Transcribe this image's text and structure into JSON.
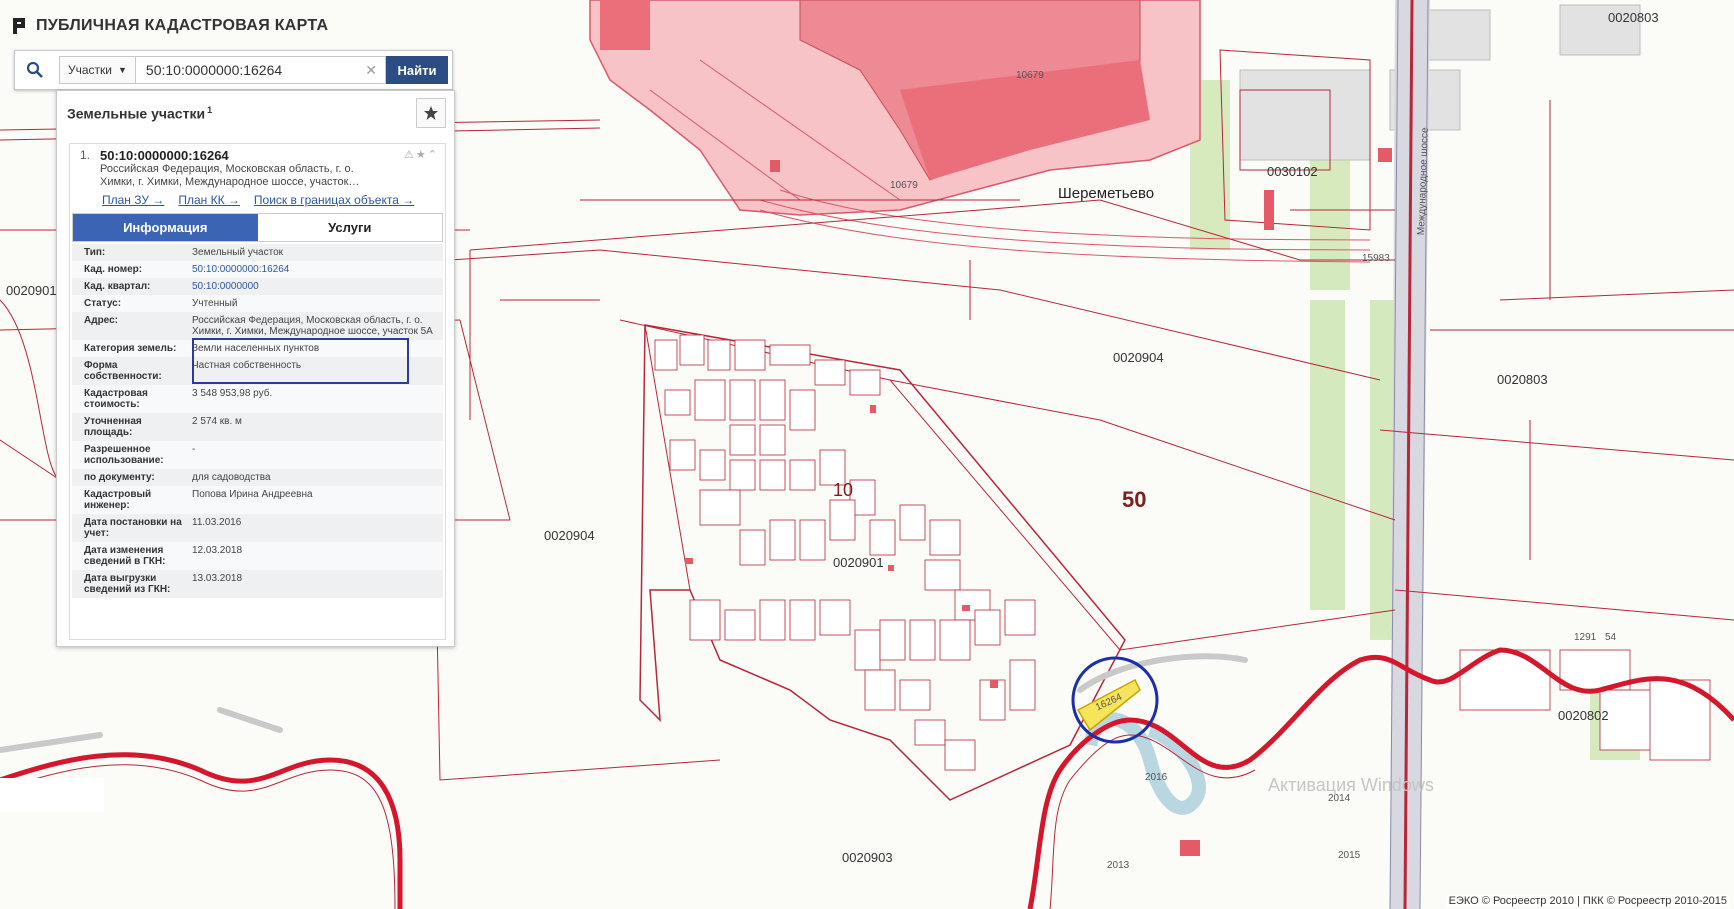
{
  "header": {
    "title": "ПУБЛИЧНАЯ КАДАСТРОВАЯ КАРТА"
  },
  "search": {
    "type_label": "Участки",
    "query": "50:10:0000000:16264",
    "find_label": "Найти"
  },
  "panel": {
    "title": "Земельные участки",
    "count": "1",
    "result": {
      "index": "1.",
      "cad_number": "50:10:0000000:16264",
      "address_short_1": "Российская Федерация, Московская область, г. о.",
      "address_short_2": "Химки, г. Химки, Международное шоссе, участок…",
      "links": [
        "План ЗУ →",
        "План КК →",
        "Поиск в границах объекта →"
      ]
    },
    "tabs": {
      "info": "Информация",
      "services": "Услуги"
    },
    "rows": [
      {
        "k": "Тип:",
        "v": "Земельный участок"
      },
      {
        "k": "Кад. номер:",
        "v": "50:10:0000000:16264"
      },
      {
        "k": "Кад. квартал:",
        "v": "50:10:0000000"
      },
      {
        "k": "Статус:",
        "v": "Учтенный"
      },
      {
        "k": "Адрес:",
        "v": "Российская Федерация, Московская область, г. о. Химки, г. Химки, Международное шоссе, участок 5А"
      },
      {
        "k": "Категория земель:",
        "v": "Земли населенных пунктов"
      },
      {
        "k": "Форма собственности:",
        "v": "Частная собственность"
      },
      {
        "k": "Кадастровая стоимость:",
        "v": "3 548 953,98 руб."
      },
      {
        "k": "Уточненная площадь:",
        "v": "2 574 кв. м"
      },
      {
        "k": "Разрешенное использование:",
        "v": "-"
      },
      {
        "k": "по документу:",
        "v": "для садоводства"
      },
      {
        "k": "Кадастровый инженер:",
        "v": "Попова Ирина Андреевна"
      },
      {
        "k": "Дата постановки на учет:",
        "v": "11.03.2016"
      },
      {
        "k": "Дата изменения сведений в ГКН:",
        "v": "12.03.2018"
      },
      {
        "k": "Дата выгрузки сведений из ГКН:",
        "v": "13.03.2018"
      }
    ]
  },
  "map": {
    "labels": {
      "sheremetyevo": "Шереметьево",
      "num10": "10",
      "num50": "50",
      "q0020904a": "0020904",
      "q0020904b": "0020904",
      "q0020901": "0020901",
      "q0020903": "0020903",
      "q0020803a": "0020803",
      "q0020803b": "0020803",
      "q0030102": "0030102",
      "q0020802": "0020802",
      "q0020901left": "0020901",
      "highway": "Международное шоссе",
      "highlighted": "16264",
      "n10679a": "10679",
      "n10679b": "10679",
      "n15983": "15983",
      "n2016": "2016",
      "n2014": "2014",
      "n2015": "2015",
      "n2013": "2013",
      "n1291": "1291",
      "n54": "54"
    }
  },
  "attribution": "ЕЭКО © Росреестр 2010 | ПКК © Росреестр 2010-2015",
  "watermark": "Активация Windows",
  "colors": {
    "accent": "#2c4d84",
    "parcel_line": "#b8263a",
    "airport_fill": "#f08a93",
    "highlight": "#f6e55a"
  }
}
